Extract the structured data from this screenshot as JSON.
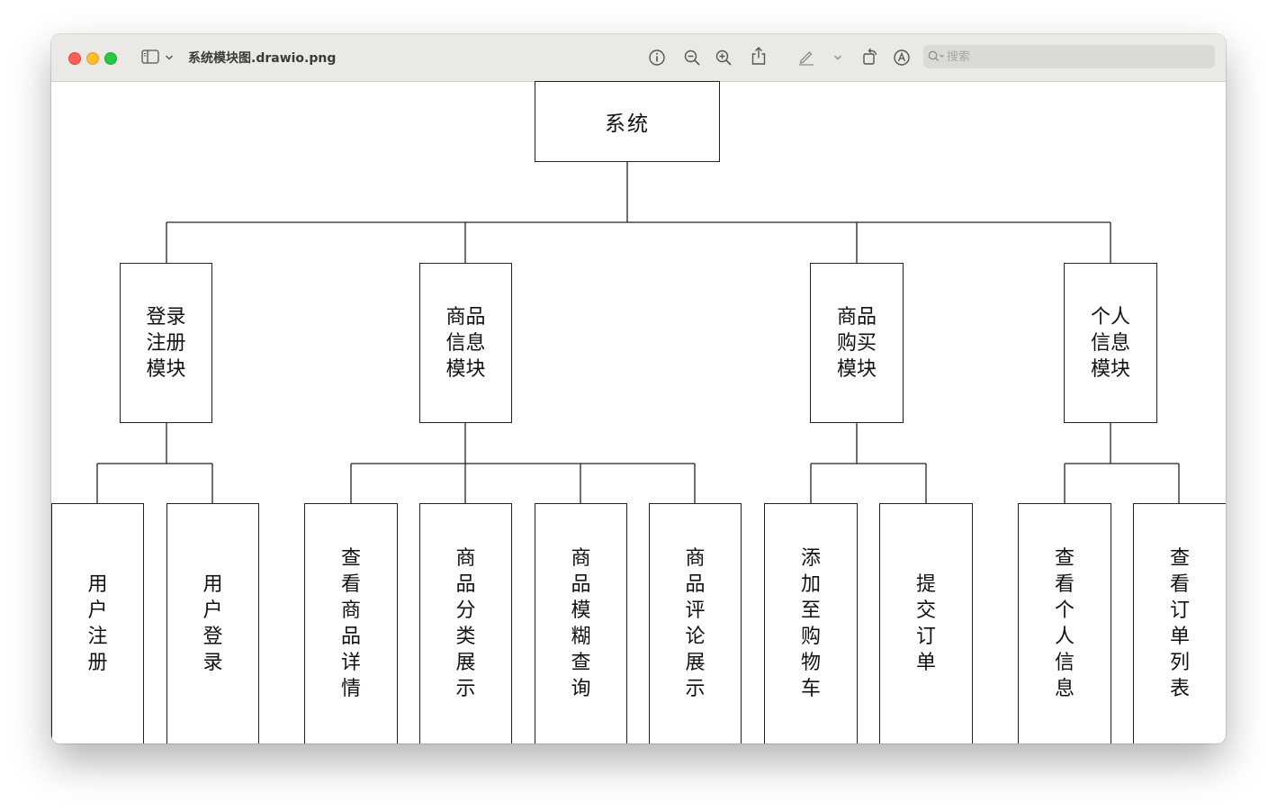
{
  "window": {
    "title": "系统模块图.drawio.png",
    "search_placeholder": "搜索",
    "toolbar_icons": [
      "sidebar-toggle-icon",
      "chevron-down-icon",
      "info-icon",
      "zoom-out-icon",
      "zoom-in-icon",
      "share-icon",
      "markup-pen-icon",
      "chevron-down-icon",
      "rotate-icon",
      "markup-circle-icon",
      "search-icon"
    ]
  },
  "diagram": {
    "root": "系统",
    "modules": [
      {
        "label": "登录注册模块",
        "children": [
          "用户注册",
          "用户登录"
        ]
      },
      {
        "label": "商品信息模块",
        "children": [
          "查看商品详情",
          "商品分类展示",
          "商品模糊查询",
          "商品评论展示"
        ]
      },
      {
        "label": "商品购买模块",
        "children": [
          "添加至购物车",
          "提交订单"
        ]
      },
      {
        "label": "个人信息模块",
        "children": [
          "查看个人信息",
          "查看订单列表"
        ]
      }
    ]
  }
}
